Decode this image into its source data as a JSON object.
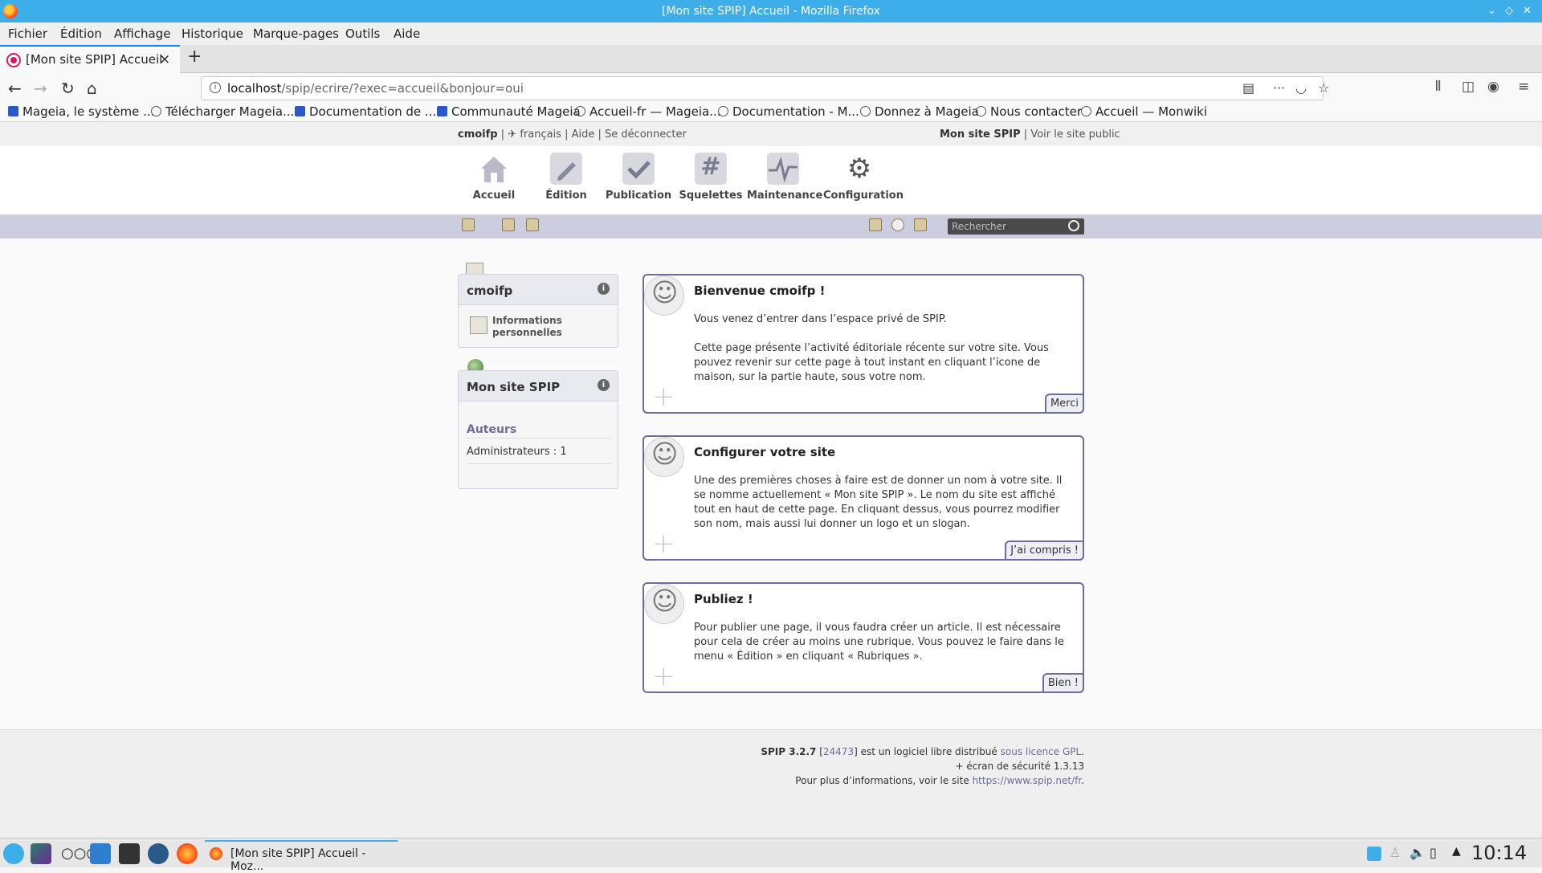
{
  "window": {
    "title": "[Mon site SPIP] Accueil - Mozilla Firefox"
  },
  "menu": [
    "Fichier",
    "Édition",
    "Affichage",
    "Historique",
    "Marque-pages",
    "Outils",
    "Aide"
  ],
  "tab": {
    "label": "[Mon site SPIP] Accueil",
    "close": "×",
    "new": "+"
  },
  "url": {
    "host": "localhost",
    "path": "/spip/ecrire/?exec=accueil&bonjour=oui"
  },
  "bookmarks": [
    "Mageia, le système ...",
    "Télécharger Mageia...",
    "Documentation de ...",
    "Communauté Mageia",
    "Accueil-fr — Mageia...",
    "Documentation - M...",
    "Donnez à Mageia",
    "Nous contacter",
    "Accueil — Monwiki"
  ],
  "topinfo": {
    "user": "cmoifp",
    "lang": "français",
    "help": "Aide",
    "logout": "Se déconnecter",
    "site": "Mon site SPIP",
    "view_public": "Voir le site public"
  },
  "mainnav": [
    "Accueil",
    "Édition",
    "Publication",
    "Squelettes",
    "Maintenance",
    "Configuration"
  ],
  "search": {
    "placeholder": "Rechercher"
  },
  "userbox": {
    "name": "cmoifp",
    "info_label": "Informations personnelles"
  },
  "sitebox": {
    "name": "Mon site SPIP",
    "section": "Auteurs",
    "admins": "Administrateurs : 1"
  },
  "cards": [
    {
      "title": "Bienvenue cmoifp !",
      "p1": "Vous venez d’entrer dans l’espace privé de SPIP.",
      "p2": "Cette page présente l’activité éditoriale récente sur votre site. Vous pouvez revenir sur cette page à tout instant en cliquant l’icone de maison, sur la partie haute, sous votre nom.",
      "button": "Merci"
    },
    {
      "title": "Configurer votre site",
      "p1": "Une des premières choses à faire est de donner un nom à votre site. Il se nomme actuellement « Mon site SPIP ». Le nom du site est affiché tout en haut de cette page. En cliquant dessus, vous pourrez modifier son nom, mais aussi lui donner un logo et un slogan.",
      "button": "J’ai compris !"
    },
    {
      "title": "Publiez !",
      "p1": "Pour publier une page, il vous faudra créer un article. Il est nécessaire pour cela de créer au moins une rubrique. Vous pouvez le faire dans le menu « Édition » en cliquant « Rubriques ».",
      "button": "Bien !"
    }
  ],
  "footer": {
    "version": "SPIP 3.2.7",
    "rev": "24473",
    "text1": "est un logiciel libre distribué",
    "license": "sous licence GPL",
    "ecran": "+ écran de sécurité 1.3.13",
    "more": "Pour plus d’informations, voir le site",
    "site_url": "https://www.spip.net/fr"
  },
  "taskbar": {
    "window": "[Mon site SPIP] Accueil - Moz...",
    "clock": "10:14"
  }
}
